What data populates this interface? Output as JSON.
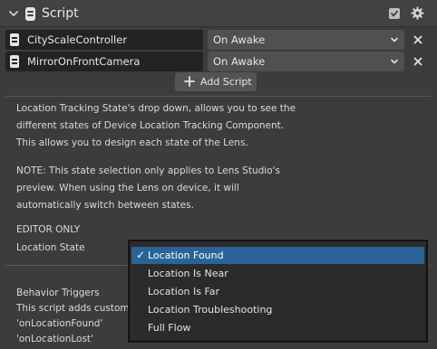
{
  "component": {
    "title": "Script"
  },
  "scripts": [
    {
      "name": "CityScaleController",
      "event": "On Awake"
    },
    {
      "name": "MirrorOnFrontCamera",
      "event": "On Awake"
    }
  ],
  "add_script_label": "Add Script",
  "description": {
    "lines1": [
      "Location Tracking State's drop down, allows you to see the",
      "different states of Device Location Tracking Component.",
      "This allows you to design each state of the Lens."
    ],
    "lines2": [
      "NOTE: This state selection only applies to Lens Studio's",
      "preview. When using the Lens on device, it will",
      "automatically switch between states."
    ]
  },
  "editor_only_label": "EDITOR ONLY",
  "location_state": {
    "label": "Location State",
    "options": [
      "Location Found",
      "Location Is Near",
      "Location Is Far",
      "Location Troubleshooting",
      "Full Flow"
    ],
    "selected": "Location Found",
    "checkmark": "✓"
  },
  "behavior_triggers": {
    "lines": [
      "Behavior Triggers",
      "This script adds custom",
      "'onLocationFound'",
      "'onLocationLost'"
    ]
  },
  "colors": {
    "panel_bg": "#3c3c3c",
    "field_bg": "#232323",
    "dropdown_bg": "#505050",
    "menu_highlight": "#2a6496"
  },
  "icons": {
    "collapse": "chevron-down-icon",
    "script": "script-icon",
    "enabled": "checkbox-icon",
    "settings": "gear-icon",
    "remove": "close-icon",
    "add": "plus-circle-icon"
  }
}
